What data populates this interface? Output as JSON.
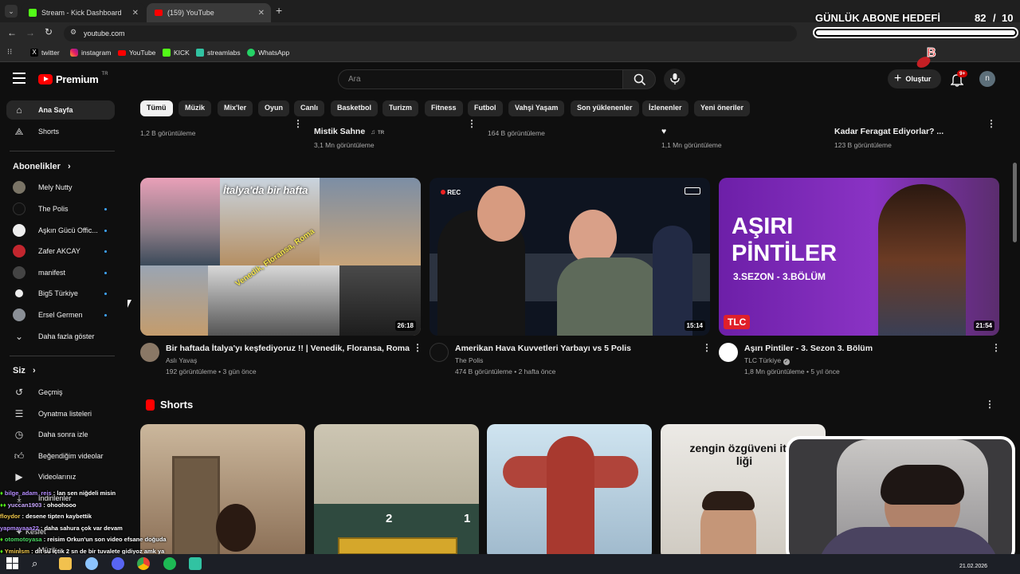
{
  "browser": {
    "tabs": [
      {
        "title": "Stream - Kick Dashboard",
        "active": false
      },
      {
        "title": "(159) YouTube",
        "active": true
      }
    ],
    "url": "youtube.com",
    "bookmarks": [
      "twitter",
      "instagram",
      "YouTube",
      "KICK",
      "streamlabs",
      "WhatsApp"
    ]
  },
  "overlay_goal": {
    "label": "GÜNLÜK ABONE HEDEFİ",
    "current": "82",
    "separator": "/",
    "target": "10"
  },
  "header": {
    "logo_text": "Premium",
    "logo_badge": "TR",
    "search_placeholder": "Ara",
    "create_label": "Oluştur",
    "notif_badge": "9+",
    "avatar_letter": "n"
  },
  "chips": [
    "Tümü",
    "Müzik",
    "Mix'ler",
    "Oyun",
    "Canlı",
    "Basketbol",
    "Turizm",
    "Fitness",
    "Futbol",
    "Vahşi Yaşam",
    "Son yüklenenler",
    "İzlenenler",
    "Yeni öneriler"
  ],
  "sidebar": {
    "main": [
      {
        "label": "Ana Sayfa",
        "icon": "home-icon"
      },
      {
        "label": "Shorts",
        "icon": "shorts-icon"
      }
    ],
    "subs_title": "Abonelikler",
    "subs": [
      {
        "label": "Mely Nutty",
        "dot": false,
        "color": "#7a7466"
      },
      {
        "label": "The Polis",
        "dot": true,
        "color": "#111111"
      },
      {
        "label": "Aşkın Gücü Offic...",
        "dot": true,
        "color": "#eeeeee"
      },
      {
        "label": "Zafer AKCAY",
        "dot": true,
        "color": "#c2262e"
      },
      {
        "label": "manifest",
        "dot": true,
        "color": "#333333"
      },
      {
        "label": "Big5 Türkiye",
        "dot": true,
        "color": "#eeeeee"
      },
      {
        "label": "Ersel Germen",
        "dot": true,
        "color": "#8a8f96"
      }
    ],
    "more_label": "Daha fazla göster",
    "you_title": "Siz",
    "you": [
      {
        "label": "Geçmiş",
        "icon": "history-icon"
      },
      {
        "label": "Oynatma listeleri",
        "icon": "playlist-icon"
      },
      {
        "label": "Daha sonra izle",
        "icon": "clock-icon"
      },
      {
        "label": "Beğendiğim videolar",
        "icon": "thumbs-up-icon"
      },
      {
        "label": "Videolarınız",
        "icon": "video-icon"
      },
      {
        "label": "İndirilenler",
        "icon": "download-icon"
      },
      {
        "label": "Kesfet",
        "icon": "explore-icon"
      },
      {
        "label": "Müzik",
        "icon": "music-icon"
      }
    ]
  },
  "top_row": [
    {
      "title": "",
      "meta": "1,2 B görüntüleme"
    },
    {
      "title": "Mistik Sahne",
      "badge": "TR",
      "meta": "3,1 Mn görüntüleme"
    },
    {
      "title": "",
      "meta": "164 B görüntüleme"
    },
    {
      "title": "♥",
      "meta": "1,1 Mn görüntüleme"
    },
    {
      "title": "Kadar Feragat Ediyorlar? ...",
      "meta": "123 B görüntüleme"
    }
  ],
  "videos": [
    {
      "title": "Bir haftada İtalya'yı keşfediyoruz !! | Venedik, Floransa, Roma",
      "channel": "Aslı Yavaş",
      "views": "192 görüntüleme",
      "age": "3 gün önce",
      "duration": "26:18",
      "thumb_text": "İtalya'da bir hafta",
      "thumb_text2": "Venedik, Floransa, Roma"
    },
    {
      "title": "Amerikan Hava Kuvvetleri Yarbayı vs 5 Polis",
      "channel": "The Polis",
      "views": "474 B görüntüleme",
      "age": "2 hafta önce",
      "duration": "15:14",
      "thumb_text": "REC"
    },
    {
      "title": "Aşırı Pintiler - 3. Sezon 3. Bölüm",
      "channel": "TLC Türkiye",
      "views": "1,8 Mn görüntüleme",
      "age": "5 yıl önce",
      "duration": "21:54",
      "thumb_text": "AŞIRI PİNTİLER",
      "thumb_text2": "3.SEZON - 3.BÖLÜM",
      "thumb_logo": "TLC"
    }
  ],
  "separator": "•",
  "shorts": {
    "title": "Shorts",
    "items": [
      {
        "overlay": ""
      },
      {
        "overlay": "2",
        "overlay2": "1"
      },
      {
        "overlay": ""
      },
      {
        "overlay": "zengin özgüveni itici liği"
      }
    ]
  },
  "chat": [
    {
      "user": "bilge_adam_reis",
      "msg": " : lan sen niğdeli misin",
      "color": "#b58cff"
    },
    {
      "user": "yuccan1903",
      "msg": " : ohoohooo",
      "color": "#c9a7ff"
    },
    {
      "user": "floydor",
      "msg": " : desene tipten kaybettik",
      "color": "#f2c94c"
    },
    {
      "user": "yapmayaaa22",
      "msg": " : daha sahura çok var devam",
      "color": "#b58cff"
    },
    {
      "user": "otomotoyasa",
      "msg": " : reisim Orkun'un son video efsane doğuda",
      "color": "#4cd964"
    },
    {
      "user": "Yminism",
      "msg": " : dit su içtik 2 sn de bir tuvalete gidiyoz amk ya",
      "color": "#f2c94c"
    }
  ],
  "taskbar": {
    "date": "21.02.2026"
  },
  "colors": {
    "youtube_red": "#ff0000",
    "accent_blue": "#3ea6ff",
    "kick_green": "#53fc18",
    "tlc_red": "#e0202a",
    "pintiler_purple": "#7e2ab8"
  }
}
